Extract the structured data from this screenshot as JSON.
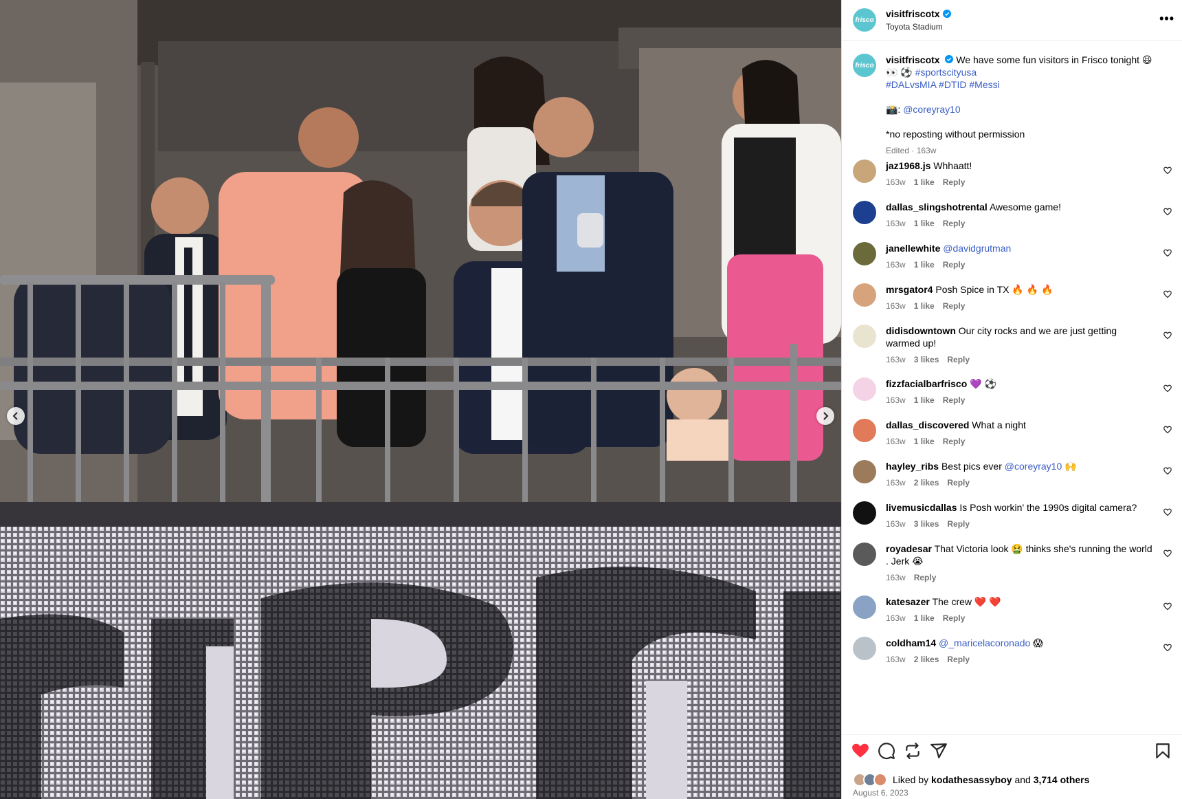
{
  "post": {
    "username": "visitfriscotx",
    "location": "Toyota Stadium",
    "more_label": "•••",
    "avatar_text": "frisco"
  },
  "caption": {
    "username": "visitfriscotx",
    "line1": "We have some fun visitors in Frisco tonight 😆",
    "line2_emoji": "👀 ⚽",
    "hashtag1": "#sportscityusa",
    "hashtag2": "#DALvsMIA",
    "hashtag3": "#DTID",
    "hashtag4": "#Messi",
    "credit_prefix": "📸:",
    "credit_handle": "@coreyray10",
    "note": "*no reposting without permission",
    "meta": "Edited · 163w"
  },
  "comments": [
    {
      "username": "jaz1968.js",
      "text": "Whhaatt!",
      "mention": "",
      "suffix": "",
      "time": "163w",
      "likes": "1 like",
      "reply": "Reply",
      "avatar_color": "#c9a67a"
    },
    {
      "username": "dallas_slingshotrental",
      "text": "Awesome game!",
      "mention": "",
      "suffix": "",
      "time": "163w",
      "likes": "1 like",
      "reply": "Reply",
      "avatar_color": "#1d3f8f"
    },
    {
      "username": "janellewhite",
      "text": "",
      "mention": "@davidgrutman",
      "suffix": "",
      "time": "163w",
      "likes": "1 like",
      "reply": "Reply",
      "avatar_color": "#6b6a3a"
    },
    {
      "username": "mrsgator4",
      "text": "Posh Spice in TX 🔥 🔥 🔥",
      "mention": "",
      "suffix": "",
      "time": "163w",
      "likes": "1 like",
      "reply": "Reply",
      "avatar_color": "#d6a37c"
    },
    {
      "username": "didisdowntown",
      "text": "Our city rocks and we are just getting warmed up!",
      "mention": "",
      "suffix": "",
      "time": "163w",
      "likes": "3 likes",
      "reply": "Reply",
      "avatar_color": "#e9e4d0"
    },
    {
      "username": "fizzfacialbarfrisco",
      "text": "💜 ⚽",
      "mention": "",
      "suffix": "",
      "time": "163w",
      "likes": "1 like",
      "reply": "Reply",
      "avatar_color": "#f4d3e6"
    },
    {
      "username": "dallas_discovered",
      "text": "What a night",
      "mention": "",
      "suffix": "",
      "time": "163w",
      "likes": "1 like",
      "reply": "Reply",
      "avatar_color": "#e07a58"
    },
    {
      "username": "hayley_ribs",
      "text": "Best pics ever",
      "mention": "@coreyray10",
      "suffix": "🙌",
      "time": "163w",
      "likes": "2 likes",
      "reply": "Reply",
      "avatar_color": "#9c7b5a"
    },
    {
      "username": "livemusicdallas",
      "text": "Is Posh workin' the 1990s digital camera?",
      "mention": "",
      "suffix": "",
      "time": "163w",
      "likes": "3 likes",
      "reply": "Reply",
      "avatar_color": "#111111"
    },
    {
      "username": "royadesar",
      "text": "That Victoria look 🤮 thinks she's running the world . Jerk 😭",
      "mention": "",
      "suffix": "",
      "time": "163w",
      "likes": "",
      "reply": "Reply",
      "avatar_color": "#5a5a5a"
    },
    {
      "username": "katesazer",
      "text": "The crew ❤️ ❤️",
      "mention": "",
      "suffix": "",
      "time": "163w",
      "likes": "1 like",
      "reply": "Reply",
      "avatar_color": "#8aa3c4"
    },
    {
      "username": "coldham14",
      "text": "",
      "mention": "@_maricelacoronado",
      "suffix": "😱",
      "time": "163w",
      "likes": "2 likes",
      "reply": "Reply",
      "avatar_color": "#b9c2c9"
    }
  ],
  "actions": {
    "liked_by_prefix": "Liked by",
    "liked_by_user": "kodathesassyboy",
    "and": "and",
    "others": "3,714 others",
    "date": "August 6, 2023"
  },
  "colors": {
    "like_red": "#ff3040",
    "link_blue": "#3b5ec4",
    "muted": "#737373",
    "verified_blue": "#0095f6"
  }
}
